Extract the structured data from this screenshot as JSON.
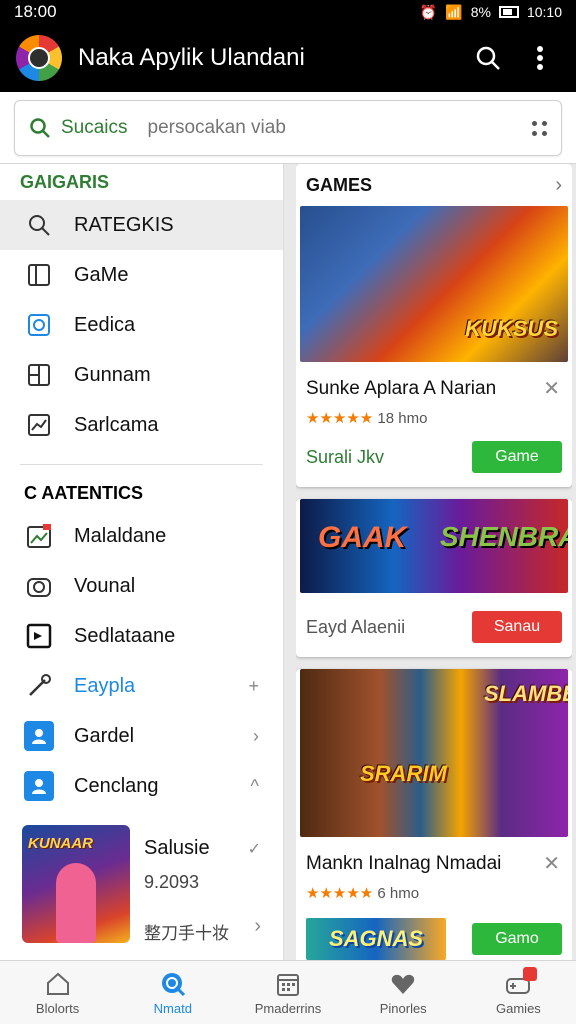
{
  "status": {
    "time": "18:00",
    "battery": "8%",
    "clock_right": "10:10"
  },
  "appbar": {
    "title": "Naka Apylik Ulandani"
  },
  "search": {
    "label": "Sucaics",
    "placeholder": "persocakan viab"
  },
  "left": {
    "section1_title": "GAIGARIS",
    "items1": [
      {
        "label": "RATEGKIS",
        "icon": "search-icon"
      },
      {
        "label": "GaMe",
        "icon": "book-icon"
      },
      {
        "label": "Eedica",
        "icon": "target-icon"
      },
      {
        "label": "Gunnam",
        "icon": "layout-icon"
      },
      {
        "label": "Sarlcama",
        "icon": "chart-icon"
      }
    ],
    "section2_title": "C AATENTICS",
    "items2": [
      {
        "label": "Malaldane",
        "icon": "image-icon"
      },
      {
        "label": "Vounal",
        "icon": "camera-icon"
      },
      {
        "label": "Sedlataane",
        "icon": "film-icon"
      },
      {
        "label": "Eaypla",
        "icon": "pen-icon",
        "trail": "+"
      },
      {
        "label": "Gardel",
        "icon": "person-icon",
        "trail": "›"
      },
      {
        "label": "Cenclang",
        "icon": "person-icon",
        "trail": "^"
      }
    ],
    "feature": {
      "thumb_text": "KUNAAR",
      "name": "Salusie",
      "rating": "9.2093",
      "meta": "整刀手十妆"
    }
  },
  "right": {
    "header": "GAMES",
    "card1": {
      "banner_text": "KUKSUS",
      "title": "Sunke Aplara A Narian",
      "stars": "★★★★★",
      "rating_text": "18 hmo",
      "action_label": "Surali Jkv",
      "button": "Game"
    },
    "card2": {
      "banner_text_1": "GAAK",
      "banner_text_2": "SHENBRA",
      "action_label": "Eayd Alaenii",
      "button": "Sanau"
    },
    "card3": {
      "banner_text_1": "SRARIM",
      "banner_text_2": "SLAMBE",
      "title": "Mankn Inalnag Nmadai",
      "stars": "★★★★★",
      "rating_text": "6 hmo"
    },
    "card4": {
      "banner_text": "SAGNAS",
      "button": "Gamo"
    }
  },
  "bottom_nav": [
    {
      "label": "Blolorts",
      "icon": "home-icon"
    },
    {
      "label": "Nmatd",
      "icon": "search-icon"
    },
    {
      "label": "Pmaderrins",
      "icon": "calendar-icon"
    },
    {
      "label": "Pinorles",
      "icon": "heart-icon"
    },
    {
      "label": "Gamies",
      "icon": "gamepad-icon"
    }
  ],
  "colors": {
    "accent_green": "#2e7d32",
    "button_green": "#2eb83b",
    "button_red": "#e53935",
    "accent_blue": "#1e88e5"
  }
}
